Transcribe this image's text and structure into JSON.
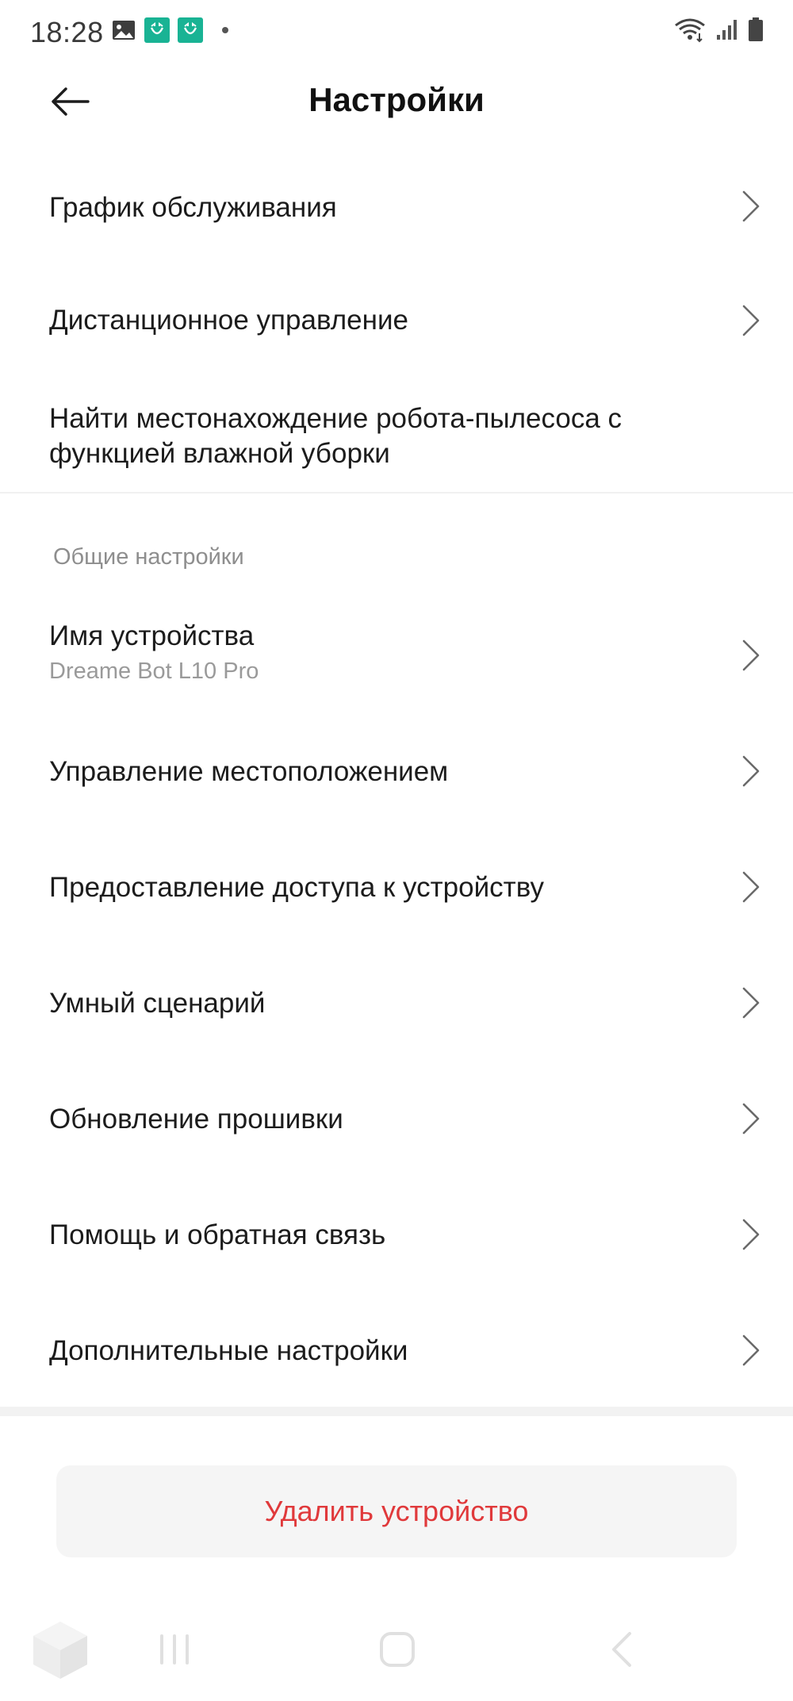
{
  "status_bar": {
    "time": "18:28",
    "icons_left": [
      "image-icon",
      "mi-home-icon",
      "mi-home-icon",
      "notification-dot"
    ],
    "icons_right": [
      "wifi-icon",
      "signal-icon",
      "battery-icon"
    ]
  },
  "header": {
    "title": "Настройки",
    "back_icon": "arrow-left-icon"
  },
  "items_top": [
    {
      "label": "График обслуживания",
      "chevron": true
    },
    {
      "label": "Дистанционное управление",
      "chevron": true
    },
    {
      "label_line1": "Найти местонахождение робота-пылесоса с",
      "label_line2": "функцией влажной уборки",
      "chevron": false
    }
  ],
  "general": {
    "section_title": "Общие настройки",
    "device_name": {
      "label": "Имя устройства",
      "value": "Dreame Bot L10 Pro"
    },
    "items": [
      {
        "label": "Управление местоположением"
      },
      {
        "label": "Предоставление доступа к устройству"
      },
      {
        "label": "Умный сценарий"
      },
      {
        "label": "Обновление прошивки"
      },
      {
        "label": "Помощь и обратная связь"
      },
      {
        "label": "Дополнительные настройки"
      }
    ]
  },
  "delete_button": {
    "label": "Удалить устройство"
  },
  "colors": {
    "accent_red": "#e0393b",
    "mi_green": "#19b394",
    "sub_text": "#9a9a9a",
    "button_bg": "#f5f5f5"
  },
  "nav_bar": {
    "icons": [
      "app-cube-icon",
      "recents-icon",
      "home-icon",
      "back-icon"
    ]
  }
}
